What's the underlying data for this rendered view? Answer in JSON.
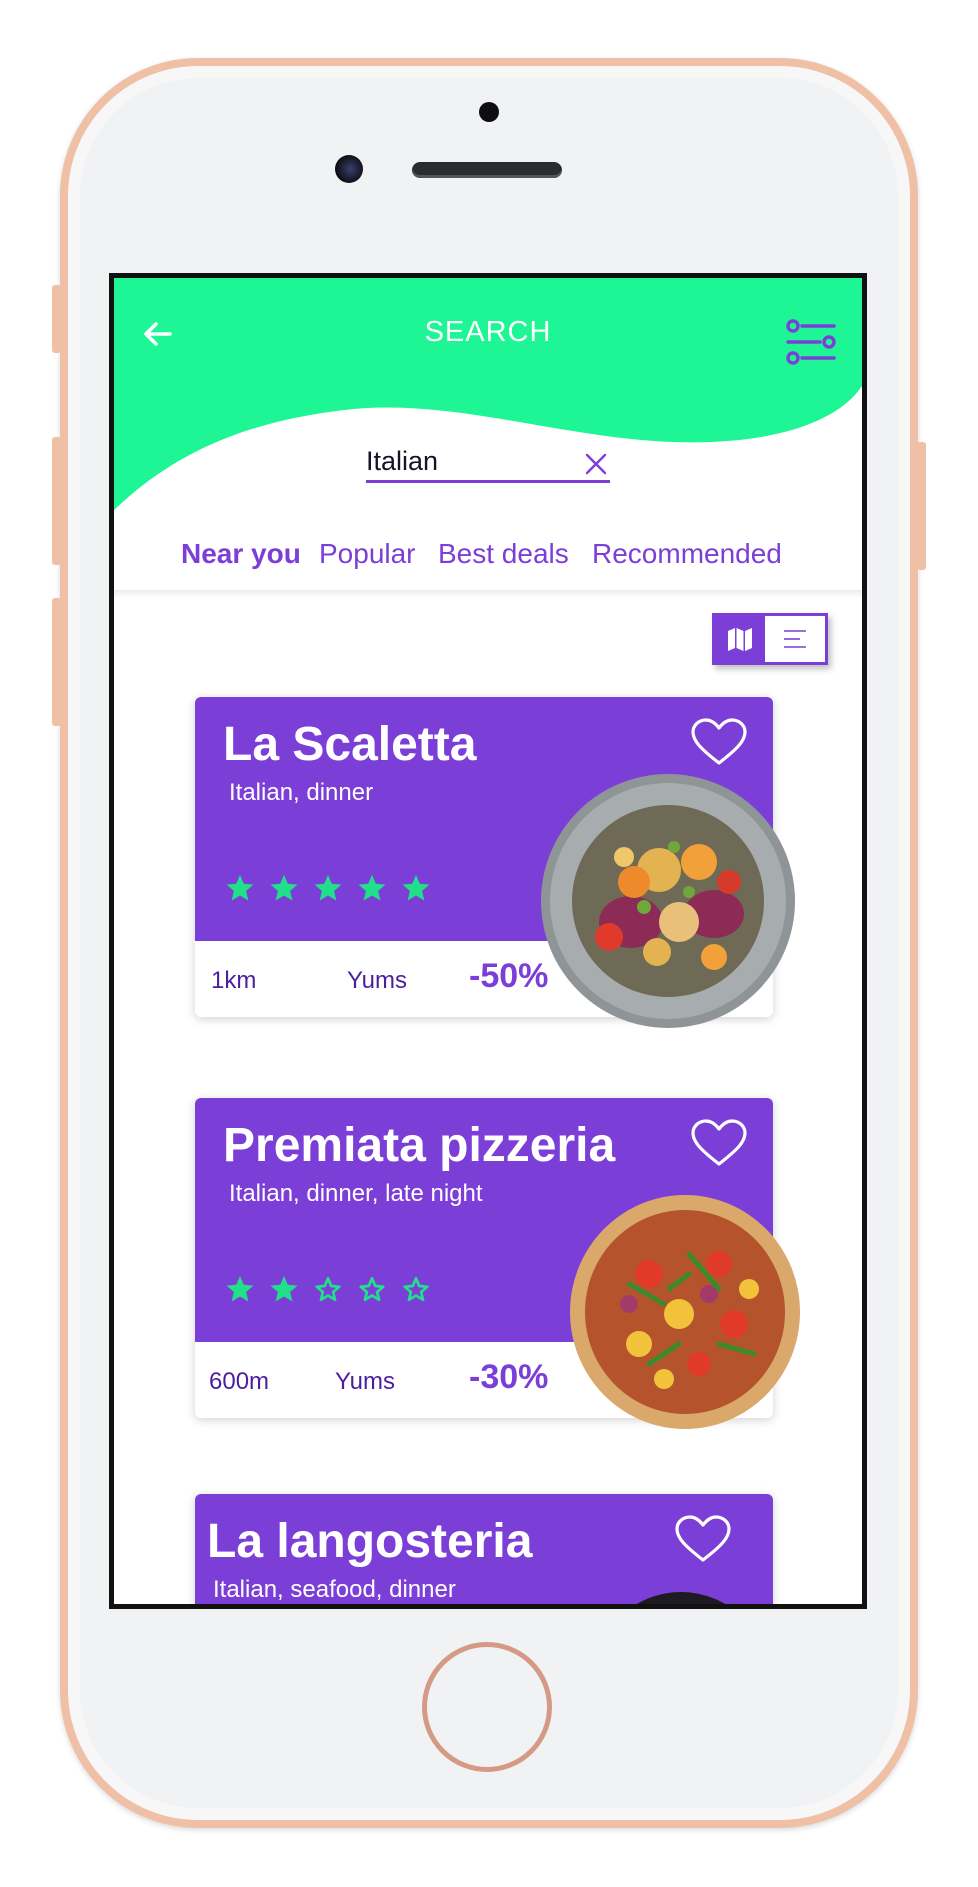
{
  "header": {
    "title": "SEARCH",
    "back_icon": "arrow-left-icon",
    "filter_icon": "sliders-icon"
  },
  "search": {
    "value": "Italian",
    "clear_icon": "close-icon"
  },
  "tabs": [
    {
      "label": "Near you",
      "active": true
    },
    {
      "label": "Popular",
      "active": false
    },
    {
      "label": "Best deals",
      "active": false
    },
    {
      "label": "Recommended",
      "active": false
    }
  ],
  "view_toggle": {
    "options": [
      "map-icon",
      "list-icon"
    ],
    "selected": "map"
  },
  "restaurants": [
    {
      "name": "La Scaletta",
      "tags": "Italian, dinner",
      "rating": 5,
      "distance": "1km",
      "yums": "Yums",
      "deal": "-50%",
      "image": "salad-bowl"
    },
    {
      "name": "Premiata pizzeria",
      "tags": "Italian, dinner, late night",
      "rating": 2,
      "distance": "600m",
      "yums": "Yums",
      "deal": "-30%",
      "image": "pizza"
    },
    {
      "name": "La langosteria",
      "tags": "Italian, seafood, dinner",
      "image": "seafood-plate"
    }
  ],
  "colors": {
    "accent_purple": "#7b3fd8",
    "mint_green": "#1ef594",
    "star_green": "#21e08a",
    "phone_frame": "#efbfa6"
  }
}
